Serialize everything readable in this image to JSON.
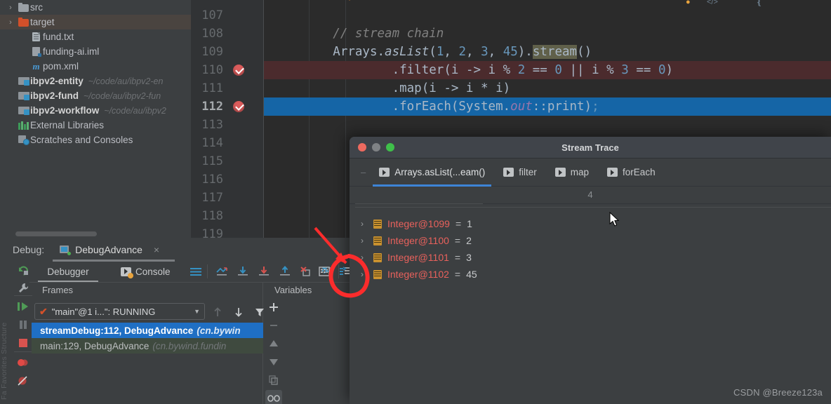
{
  "project_tree": {
    "items": [
      {
        "indent": 0,
        "twisty": "›",
        "icon": "folder-icon",
        "label": "src",
        "path": "",
        "bold": false,
        "selected": false
      },
      {
        "indent": 0,
        "twisty": "›",
        "icon": "folder-orange-icon",
        "label": "target",
        "path": "",
        "bold": false,
        "selected": true
      },
      {
        "indent": 1,
        "twisty": "",
        "icon": "file-text-icon",
        "label": "fund.txt",
        "path": "",
        "bold": false,
        "selected": false
      },
      {
        "indent": 1,
        "twisty": "",
        "icon": "iml-file-icon",
        "label": "funding-ai.iml",
        "path": "",
        "bold": false,
        "selected": false
      },
      {
        "indent": 1,
        "twisty": "",
        "icon": "maven-pom-icon",
        "label": "pom.xml",
        "path": "",
        "bold": false,
        "selected": false
      },
      {
        "indent": 0,
        "twisty": "",
        "icon": "module-icon",
        "label": "ibpv2-entity",
        "path": "~/code/au/ibpv2-en",
        "bold": true,
        "selected": false
      },
      {
        "indent": 0,
        "twisty": "",
        "icon": "module-icon",
        "label": "ibpv2-fund",
        "path": "~/code/au/ibpv2-fun",
        "bold": true,
        "selected": false
      },
      {
        "indent": 0,
        "twisty": "",
        "icon": "module-icon",
        "label": "ibpv2-workflow",
        "path": "~/code/au/ibpv2",
        "bold": true,
        "selected": false
      },
      {
        "indent": 0,
        "twisty": "",
        "icon": "external-libraries-icon",
        "label": "External Libraries",
        "path": "",
        "bold": false,
        "selected": false
      },
      {
        "indent": 0,
        "twisty": "",
        "icon": "scratches-icon",
        "label": "Scratches and Consoles",
        "path": "",
        "bold": false,
        "selected": false
      }
    ]
  },
  "editor": {
    "lines": [
      {
        "number": "107",
        "breakpoint": false,
        "current": false,
        "highlight": "none",
        "tokens": []
      },
      {
        "number": "108",
        "breakpoint": false,
        "current": false,
        "highlight": "none",
        "tokens": [
          {
            "t": "        // stream chain",
            "c": "cmt"
          }
        ]
      },
      {
        "number": "109",
        "breakpoint": false,
        "current": false,
        "highlight": "none",
        "tokens": [
          {
            "t": "        Arrays.",
            "c": ""
          },
          {
            "t": "asList",
            "c": "ital"
          },
          {
            "t": "(",
            "c": ""
          },
          {
            "t": "1",
            "c": "num"
          },
          {
            "t": ", ",
            "c": ""
          },
          {
            "t": "2",
            "c": "num"
          },
          {
            "t": ", ",
            "c": ""
          },
          {
            "t": "3",
            "c": "num"
          },
          {
            "t": ", ",
            "c": ""
          },
          {
            "t": "45",
            "c": "num"
          },
          {
            "t": ").",
            "c": ""
          },
          {
            "t": "stream",
            "c": "sel-word"
          },
          {
            "t": "()",
            "c": ""
          }
        ]
      },
      {
        "number": "110",
        "breakpoint": true,
        "current": false,
        "highlight": "red",
        "tokens": [
          {
            "t": "                .filter(i -> i % ",
            "c": ""
          },
          {
            "t": "2",
            "c": "num"
          },
          {
            "t": " == ",
            "c": ""
          },
          {
            "t": "0",
            "c": "num"
          },
          {
            "t": " || i % ",
            "c": ""
          },
          {
            "t": "3",
            "c": "num"
          },
          {
            "t": " == ",
            "c": ""
          },
          {
            "t": "0",
            "c": "num"
          },
          {
            "t": ")",
            "c": ""
          }
        ]
      },
      {
        "number": "111",
        "breakpoint": false,
        "current": false,
        "highlight": "none",
        "tokens": [
          {
            "t": "                .map(i -> i * i)",
            "c": ""
          }
        ]
      },
      {
        "number": "112",
        "breakpoint": true,
        "current": true,
        "highlight": "blue",
        "tokens": [
          {
            "t": "                .forEach(System.",
            "c": ""
          },
          {
            "t": "out",
            "c": "fld"
          },
          {
            "t": "::print)",
            "c": ""
          },
          {
            "t": ";",
            "c": "num"
          }
        ]
      },
      {
        "number": "113",
        "breakpoint": false,
        "current": false,
        "highlight": "none",
        "tokens": []
      },
      {
        "number": "114",
        "breakpoint": false,
        "current": false,
        "highlight": "none",
        "tokens": []
      },
      {
        "number": "115",
        "breakpoint": false,
        "current": false,
        "highlight": "none",
        "tokens": []
      },
      {
        "number": "116",
        "breakpoint": false,
        "current": false,
        "highlight": "none",
        "tokens": []
      },
      {
        "number": "117",
        "breakpoint": false,
        "current": false,
        "highlight": "none",
        "tokens": []
      },
      {
        "number": "118",
        "breakpoint": false,
        "current": false,
        "highlight": "none",
        "tokens": []
      },
      {
        "number": "119",
        "breakpoint": false,
        "current": false,
        "highlight": "none",
        "tokens": []
      }
    ]
  },
  "stream_trace": {
    "title": "Stream Trace",
    "tabs": [
      {
        "label": "Arrays.asList(...eam()",
        "active": true
      },
      {
        "label": "filter",
        "active": false
      },
      {
        "label": "map",
        "active": false
      },
      {
        "label": "forEach",
        "active": false
      }
    ],
    "count": "4",
    "rows": [
      {
        "chevron": "›",
        "name": "Integer@1099",
        "eq": "=",
        "value": "1"
      },
      {
        "chevron": "›",
        "name": "Integer@1100",
        "eq": "=",
        "value": "2"
      },
      {
        "chevron": "›",
        "name": "Integer@1101",
        "eq": "=",
        "value": "3"
      },
      {
        "chevron": "›",
        "name": "Integer@1102",
        "eq": "=",
        "value": "45"
      }
    ]
  },
  "debug_panel": {
    "label": "Debug:",
    "session_tab": "DebugAdvance",
    "close_glyph": "×",
    "tabs": [
      {
        "label": "Debugger",
        "active": true
      },
      {
        "label": "Console",
        "active": false
      }
    ],
    "columns": {
      "frames": "Frames",
      "variables": "Variables"
    },
    "thread_selector": "\"main\"@1 i...\": RUNNING",
    "frames": [
      {
        "location": "streamDebug:112, DebugAdvance",
        "package": "(cn.bywin",
        "state": "selected"
      },
      {
        "location": "main:129, DebugAdvance",
        "package": "(cn.bywind.fundin",
        "state": "running"
      }
    ],
    "side_rail_label": "Fa Favorites  Structure"
  },
  "watermark": "CSDN @Breeze123a",
  "colors": {
    "accent_blue": "#3d84d6",
    "selection_blue": "#1f6fc4",
    "breakpoint_red": "#db5c5c",
    "annotation_red": "#fb2c2c",
    "string_orange": "#d2502a",
    "number_blue": "#6897bb",
    "object_gold": "#c9912f",
    "value_red": "#e8615c"
  }
}
